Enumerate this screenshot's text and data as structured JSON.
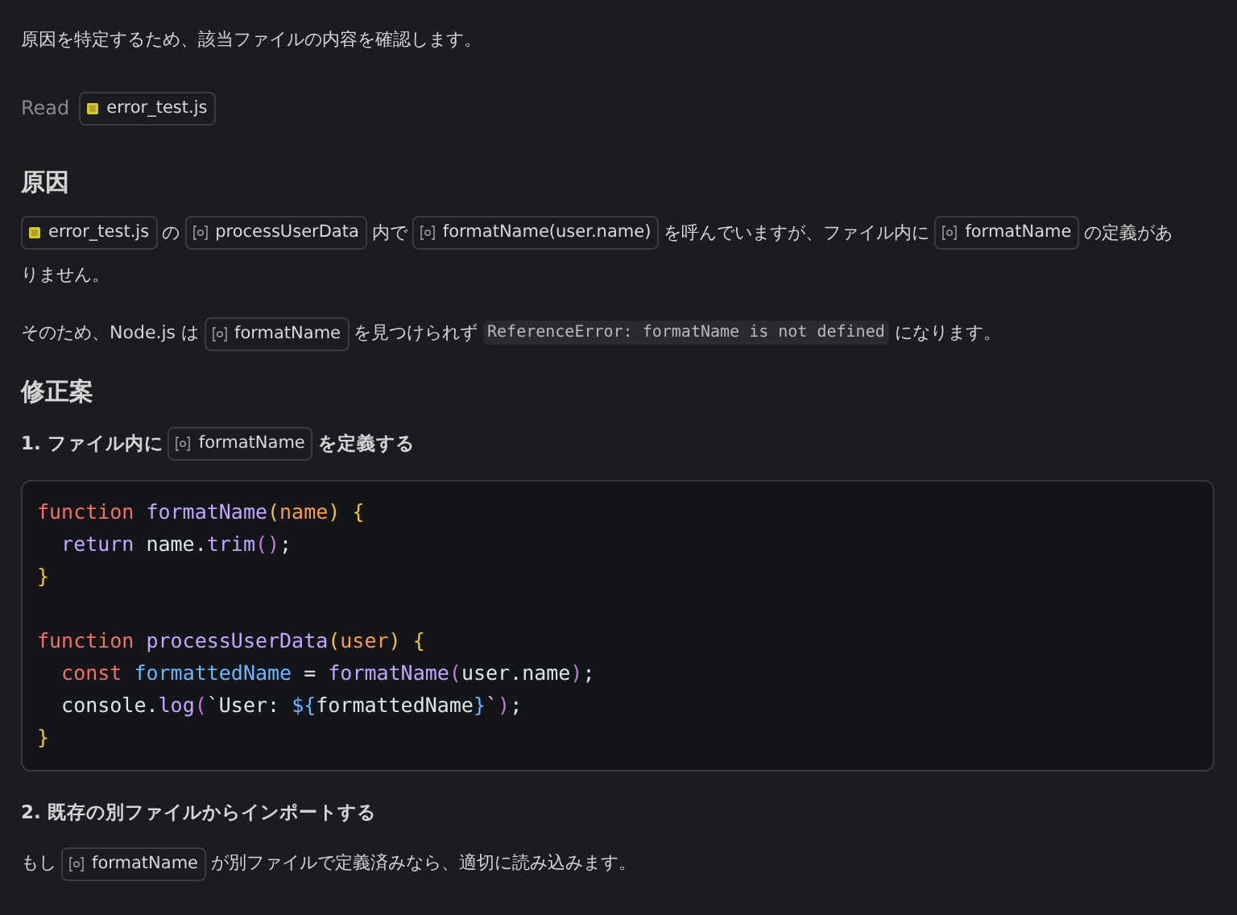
{
  "blocks": [
    {
      "kind": "para",
      "segments": [
        {
          "kind": "text",
          "text": "原因を特定するため、該当ファイルの内容を確認します。"
        }
      ]
    },
    {
      "kind": "read",
      "segments": [
        {
          "kind": "muted",
          "text": "Read"
        },
        {
          "kind": "file",
          "text": "error_test.js"
        }
      ]
    },
    {
      "kind": "heading",
      "segments": [
        {
          "kind": "text",
          "text": "原因"
        }
      ]
    },
    {
      "kind": "para",
      "segments": [
        {
          "kind": "file",
          "text": "error_test.js"
        },
        {
          "kind": "text",
          "text": "の"
        },
        {
          "kind": "symbol",
          "text": "processUserData"
        },
        {
          "kind": "text",
          "text": "内で"
        },
        {
          "kind": "symbol",
          "text": "formatName(user.name)"
        },
        {
          "kind": "text",
          "text": "を呼んでいますが、ファイル内に"
        },
        {
          "kind": "symbol",
          "text": "formatName"
        },
        {
          "kind": "text",
          "text": "の定義があ"
        },
        {
          "kind": "text",
          "text": "りません。"
        }
      ]
    },
    {
      "kind": "para",
      "segments": [
        {
          "kind": "text",
          "text": "そのため、Node.js は"
        },
        {
          "kind": "symbol",
          "text": "formatName"
        },
        {
          "kind": "text",
          "text": "を見つけられず"
        },
        {
          "kind": "code",
          "text": "ReferenceError: formatName is not defined"
        },
        {
          "kind": "text",
          "text": "になります。"
        }
      ]
    },
    {
      "kind": "heading",
      "segments": [
        {
          "kind": "text",
          "text": "修正案"
        }
      ]
    },
    {
      "kind": "step",
      "segments": [
        {
          "kind": "text",
          "text": "1. ファイル内に"
        },
        {
          "kind": "symbol",
          "text": "formatName"
        },
        {
          "kind": "text",
          "text": "を定義する"
        }
      ]
    },
    {
      "kind": "codeblock",
      "lines": [
        {
          "kind": "code",
          "tokens": [
            {
              "kind": "keyword",
              "text": "function "
            },
            {
              "kind": "func",
              "text": "formatName"
            },
            {
              "kind": "bracket",
              "text": "("
            },
            {
              "kind": "param",
              "text": "name"
            },
            {
              "kind": "bracket",
              "text": ") {"
            }
          ]
        },
        {
          "kind": "code",
          "tokens": [
            {
              "kind": "control",
              "text": "  return "
            },
            {
              "kind": "plain",
              "text": "name."
            },
            {
              "kind": "func",
              "text": "trim"
            },
            {
              "kind": "bracket2",
              "text": "()"
            },
            {
              "kind": "plain",
              "text": ";"
            }
          ]
        },
        {
          "kind": "code",
          "tokens": [
            {
              "kind": "bracket",
              "text": "}"
            }
          ]
        },
        {
          "kind": "blank"
        },
        {
          "kind": "code",
          "tokens": [
            {
              "kind": "keyword",
              "text": "function "
            },
            {
              "kind": "func",
              "text": "processUserData"
            },
            {
              "kind": "bracket",
              "text": "("
            },
            {
              "kind": "param",
              "text": "user"
            },
            {
              "kind": "bracket",
              "text": ") {"
            }
          ]
        },
        {
          "kind": "code",
          "tokens": [
            {
              "kind": "keyword",
              "text": "  const "
            },
            {
              "kind": "variable",
              "text": "formattedName"
            },
            {
              "kind": "plain",
              "text": " = "
            },
            {
              "kind": "func",
              "text": "formatName"
            },
            {
              "kind": "bracket2",
              "text": "("
            },
            {
              "kind": "plain",
              "text": "user.name"
            },
            {
              "kind": "bracket2",
              "text": ")"
            },
            {
              "kind": "plain",
              "text": ";"
            }
          ]
        },
        {
          "kind": "code",
          "tokens": [
            {
              "kind": "plain",
              "text": "  console."
            },
            {
              "kind": "func",
              "text": "log"
            },
            {
              "kind": "bracket2",
              "text": "("
            },
            {
              "kind": "plain",
              "text": "`User: "
            },
            {
              "kind": "variable",
              "text": "${"
            },
            {
              "kind": "plain",
              "text": "formattedName"
            },
            {
              "kind": "variable",
              "text": "}"
            },
            {
              "kind": "plain",
              "text": "`"
            },
            {
              "kind": "bracket2",
              "text": ")"
            },
            {
              "kind": "plain",
              "text": ";"
            }
          ]
        },
        {
          "kind": "code",
          "tokens": [
            {
              "kind": "bracket",
              "text": "}"
            }
          ]
        }
      ]
    },
    {
      "kind": "step",
      "segments": [
        {
          "kind": "text",
          "text": "2. 既存の別ファイルからインポートする"
        }
      ]
    },
    {
      "kind": "para",
      "segments": [
        {
          "kind": "text",
          "text": "もし"
        },
        {
          "kind": "symbol",
          "text": "formatName"
        },
        {
          "kind": "text",
          "text": "が別ファイルで定義済みなら、適切に読み込みます。"
        }
      ]
    }
  ]
}
